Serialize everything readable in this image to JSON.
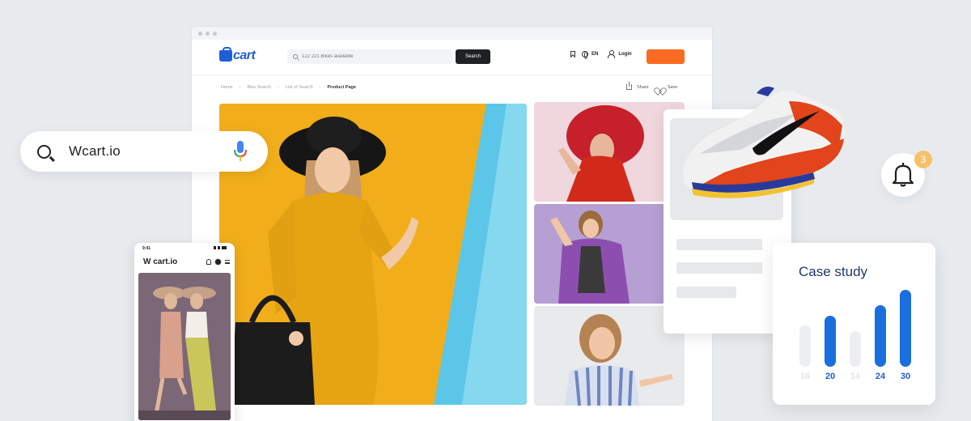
{
  "colors": {
    "brand_blue": "#1f5fd6",
    "orange_accent": "#f96b22",
    "chart_blue": "#1b6ee0",
    "chart_faint": "#eceef2",
    "badge": "#f6c06a"
  },
  "search_pill": {
    "value": "Wcart.io",
    "icons": [
      "search-icon",
      "microphone-icon"
    ]
  },
  "browser": {
    "logo": "cart",
    "search_placeholder": "122 221 Bikes available",
    "search_button": "Search",
    "language": "EN",
    "login": "Login",
    "breadcrumb": [
      "Home",
      "Bike Search",
      "List of Search",
      "Product Page"
    ],
    "share": "Share",
    "save": "Save"
  },
  "phone": {
    "time": "9:41",
    "title": "W cart.io"
  },
  "notification": {
    "count": "3"
  },
  "case_study": {
    "title": "Case study",
    "bars": [
      {
        "label": "16",
        "value": 16,
        "highlight": false
      },
      {
        "label": "20",
        "value": 20,
        "highlight": true
      },
      {
        "label": "14",
        "value": 14,
        "highlight": false
      },
      {
        "label": "24",
        "value": 24,
        "highlight": true
      },
      {
        "label": "30",
        "value": 30,
        "highlight": true
      }
    ]
  }
}
